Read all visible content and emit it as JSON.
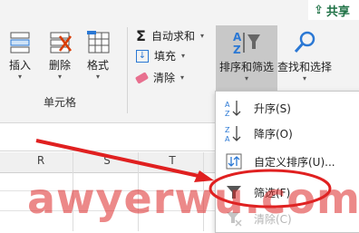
{
  "share": {
    "label": "共享"
  },
  "cells_group": {
    "insert_label": "插入",
    "delete_label": "删除",
    "format_label": "格式",
    "group_label": "单元格"
  },
  "editing_group": {
    "autosum_label": "自动求和",
    "fill_label": "填充",
    "clear_label": "清除",
    "sort_filter_label": "排序和筛选",
    "find_select_label": "查找和选择"
  },
  "columns": [
    "R",
    "S",
    "T"
  ],
  "sort_menu": {
    "items": [
      {
        "label": "升序(S)",
        "icon": "sort-ascending-icon"
      },
      {
        "label": "降序(O)",
        "icon": "sort-descending-icon"
      },
      {
        "label": "自定义排序(U)...",
        "icon": "custom-sort-icon"
      },
      {
        "label": "筛选(F)",
        "icon": "filter-icon"
      },
      {
        "label": "清除(C)",
        "icon": "clear-filter-icon",
        "disabled": true
      }
    ]
  },
  "watermark": {
    "text": "awyerwu.com"
  },
  "colors": {
    "accent_green": "#1e7145",
    "highlight_red": "#e02020",
    "icon_blue": "#2b78d4"
  }
}
